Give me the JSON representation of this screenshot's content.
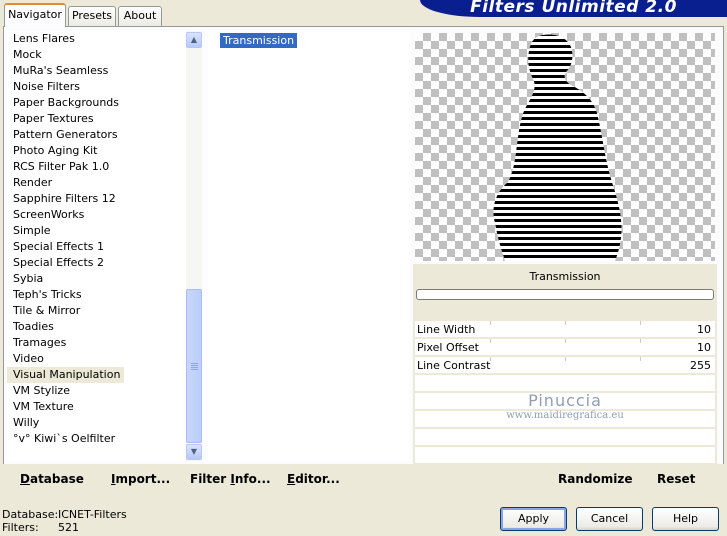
{
  "tabs": [
    {
      "label": "Navigator",
      "active": true
    },
    {
      "label": "Presets",
      "active": false
    },
    {
      "label": "About",
      "active": false
    }
  ],
  "banner": {
    "title": "Filters Unlimited 2.0",
    "color": "#0a1f8f"
  },
  "categories": {
    "items": [
      "Lens Flares",
      "Mock",
      "MuRa's Seamless",
      "Noise Filters",
      "Paper Backgrounds",
      "Paper Textures",
      "Pattern Generators",
      "Photo Aging Kit",
      "RCS Filter Pak 1.0",
      "Render",
      "Sapphire Filters 12",
      "ScreenWorks",
      "Simple",
      "Special Effects 1",
      "Special Effects 2",
      "Sybia",
      "Teph's Tricks",
      "Tile & Mirror",
      "Toadies",
      "Tramages",
      "Video",
      "Visual Manipulation",
      "VM Stylize",
      "VM Texture",
      "Willy",
      "°v° Kiwi`s Oelfilter"
    ],
    "selected": "Visual Manipulation"
  },
  "filters": {
    "items": [
      "Transmission"
    ],
    "selected": "Transmission",
    "selection_color": "#316ac5"
  },
  "preview": {
    "filter_name": "Transmission"
  },
  "params": [
    {
      "label": "Line Width",
      "value": "10"
    },
    {
      "label": "Pixel Offset",
      "value": "10"
    },
    {
      "label": "Line Contrast",
      "value": "255"
    }
  ],
  "watermark": {
    "name": "Pinuccia",
    "url": "www.maidiregrafica.eu"
  },
  "toolbar": {
    "database": {
      "prefix": "D",
      "rest": "atabase"
    },
    "import": {
      "prefix": "I",
      "rest": "mport..."
    },
    "filter_info": {
      "prefix": "Filter ",
      "ul": "I",
      "rest": "nfo..."
    },
    "editor": {
      "prefix": "E",
      "rest": "ditor..."
    },
    "randomize": "Randomize",
    "reset": "Reset"
  },
  "status": {
    "database_label": "Database:",
    "database_value": "ICNET-Filters",
    "filters_label": "Filters:",
    "filters_value": "521"
  },
  "buttons": {
    "apply": "Apply",
    "cancel": "Cancel",
    "help": "Help"
  }
}
